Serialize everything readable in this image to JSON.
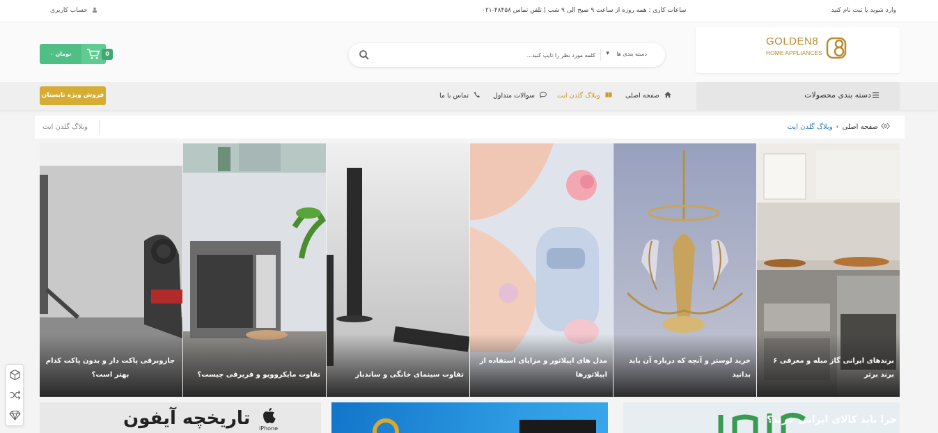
{
  "topbar": {
    "login": "وارد شوید یا ثبت نام کنید",
    "hours": "ساعات کاری : همه روزه از ساعت ۹ صبح الی ۹ شب | تلفن تماس ۴۸۴۵۸-۰۲۱",
    "account": "حساب کاربری"
  },
  "logo": {
    "name": "GOLDEN8",
    "sub": "HOME APPLIANCES"
  },
  "search": {
    "category": "دسته بندی ها",
    "placeholder": "کلمه مورد نظر را تایپ کنید..."
  },
  "cart": {
    "amount": "۰ تومان",
    "count": "0"
  },
  "nav": {
    "categories": "دسته بندی محصولات",
    "items": [
      {
        "label": "صفحه اصلی",
        "icon": "home-icon"
      },
      {
        "label": "وبلاگ گلدن ایت",
        "icon": "book-icon"
      },
      {
        "label": "سوالات متداول",
        "icon": "chat-icon"
      },
      {
        "label": "تماس با ما",
        "icon": "phone-icon"
      }
    ],
    "summer_sale": "فروش ویژه تابستان"
  },
  "breadcrumb": {
    "title": "وبلاگ گلدن ایت",
    "home": "صفحه اصلی",
    "current": "وبلاگ گلدن ایت"
  },
  "posts": [
    {
      "title": "برندهای ایرانی گاز مبله و معرفی ۶ برند برتر"
    },
    {
      "title": "خرید لوستر و آنچه که درباره آن باید بدانید"
    },
    {
      "title": "مدل های اپیلاتور و مزایای استفاده از اپیلاتورها"
    },
    {
      "title": "تفاوت سینمای خانگی و ساندبار"
    },
    {
      "title": "تفاوت مایکروویو و فریرقی چیست؟"
    },
    {
      "title": "جاروبرقی پاکت دار و بدون پاکت کدام بهتر است؟"
    }
  ],
  "banners": {
    "iphone_title": "تاریخچه آیفون",
    "iphone_label": "iPhone",
    "iran_question": "چرا باید کالای ایرانی خرید؟"
  },
  "colors": {
    "accent": "#c99a28",
    "green": "#4fbf85",
    "link": "#2a78b6"
  }
}
